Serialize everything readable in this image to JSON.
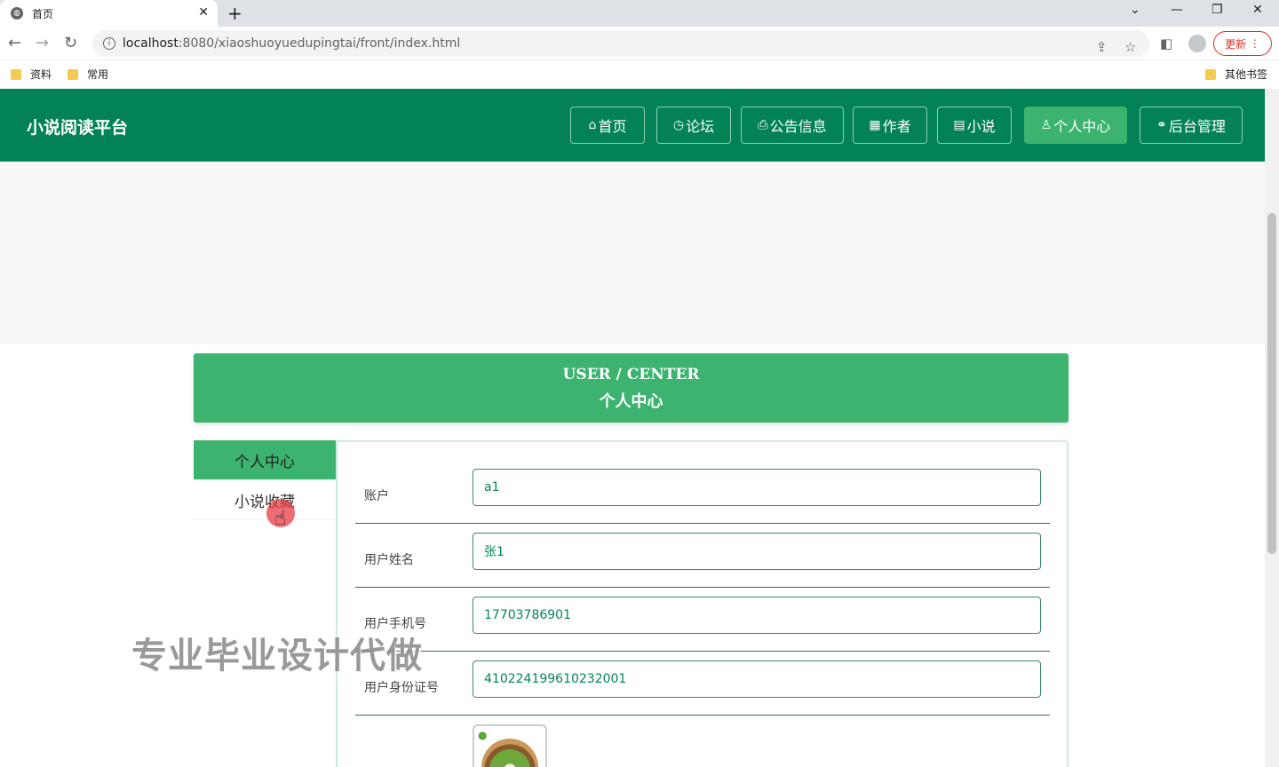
{
  "browser": {
    "tab_title": "首页",
    "tab_close": "✕",
    "new_tab": "+",
    "url_host": "localhost",
    "url_rest": ":8080/xiaoshuoyuedupingtai/front/index.html",
    "update_label": "更新",
    "bookmarks": [
      "资料",
      "常用"
    ],
    "other_bookmarks": "其他书签"
  },
  "site": {
    "title": "小说阅读平台",
    "nav": [
      {
        "icon": "⌂",
        "label": "首页"
      },
      {
        "icon": "◷",
        "label": "论坛"
      },
      {
        "icon": "⎙",
        "label": "公告信息"
      },
      {
        "icon": "▦",
        "label": "作者"
      },
      {
        "icon": "▤",
        "label": "小说"
      },
      {
        "icon": "♙",
        "label": "个人中心"
      },
      {
        "icon": "⚭",
        "label": "后台管理"
      }
    ]
  },
  "user_center": {
    "title_en": "USER / CENTER",
    "title_zh": "个人中心"
  },
  "side_menu": [
    "个人中心",
    "小说收藏"
  ],
  "form": {
    "fields": [
      {
        "label": "账户",
        "value": "a1"
      },
      {
        "label": "用户姓名",
        "value": "张1"
      },
      {
        "label": "用户手机号",
        "value": "17703786901"
      },
      {
        "label": "用户身份证号",
        "value": "410224199610232001"
      }
    ]
  },
  "watermark": "专业毕业设计代做",
  "colors": {
    "header_bg": "#038257",
    "accent": "#3cb36f"
  }
}
